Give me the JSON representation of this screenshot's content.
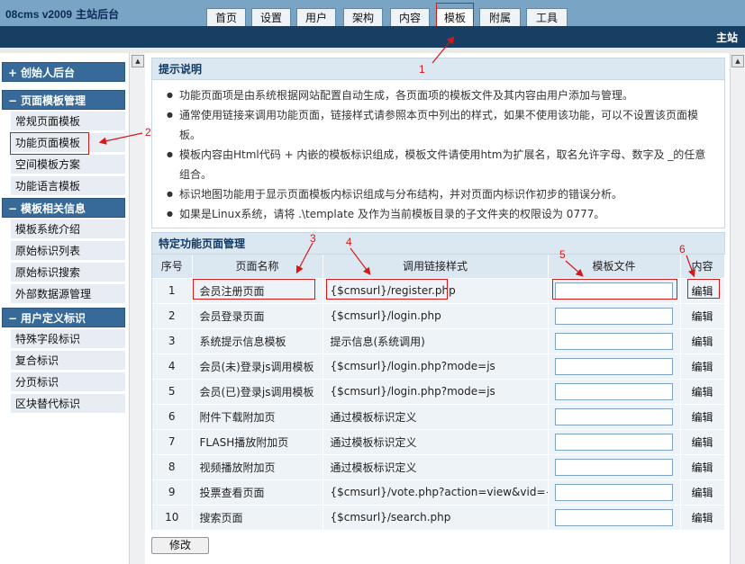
{
  "header": {
    "brand": "08cms v2009",
    "site": "主站后台",
    "nav": [
      "首页",
      "设置",
      "用户",
      "架构",
      "内容",
      "模板",
      "附属",
      "工具"
    ],
    "active_nav": "模板",
    "section_title": "主站"
  },
  "sidebar": {
    "groups": [
      {
        "symbol": "+",
        "title": "创始人后台",
        "items": []
      },
      {
        "symbol": "−",
        "title": "页面模板管理",
        "items": [
          "常规页面模板",
          "功能页面模板",
          "空间模板方案",
          "功能语言模板"
        ]
      },
      {
        "symbol": "−",
        "title": "模板相关信息",
        "items": [
          "模板系统介绍",
          "原始标识列表",
          "原始标识搜索",
          "外部数据源管理"
        ]
      },
      {
        "symbol": "−",
        "title": "用户定义标识",
        "items": [
          "特殊字段标识",
          "复合标识",
          "分页标识",
          "区块替代标识"
        ]
      }
    ]
  },
  "tips": {
    "title": "提示说明",
    "lines": [
      "功能页面项是由系统根据网站配置自动生成，各页面项的模板文件及其内容由用户添加与管理。",
      "通常使用链接来调用功能页面，链接样式请参照本页中列出的样式，如果不使用该功能，可以不设置该页面模",
      "板。",
      "模板内容由Html代码 + 内嵌的模板标识组成，模板文件请使用htm为扩展名，取名允许字母、数字及 _的任意",
      "组合。",
      "标识地图功能用于显示页面模板内标识组成与分布结构，并对页面内标识作初步的错误分析。",
      "如果是Linux系统，请将 .\\template 及作为当前模板目录的子文件夹的权限设为 0777。"
    ]
  },
  "panel": {
    "title": "特定功能页面管理",
    "columns": [
      "序号",
      "页面名称",
      "调用链接样式",
      "模板文件",
      "内容"
    ],
    "edit_label": "编辑",
    "rows": [
      {
        "no": "1",
        "name": "会员注册页面",
        "link": "{$cmsurl}/register.php",
        "file": ""
      },
      {
        "no": "2",
        "name": "会员登录页面",
        "link": "{$cmsurl}/login.php",
        "file": ""
      },
      {
        "no": "3",
        "name": "系统提示信息模板",
        "link": "提示信息(系统调用)",
        "file": ""
      },
      {
        "no": "4",
        "name": "会员(未)登录js调用模板",
        "link": "{$cmsurl}/login.php?mode=js",
        "file": ""
      },
      {
        "no": "5",
        "name": "会员(已)登录js调用模板",
        "link": "{$cmsurl}/login.php?mode=js",
        "file": ""
      },
      {
        "no": "6",
        "name": "附件下载附加页",
        "link": "通过模板标识定义",
        "file": ""
      },
      {
        "no": "7",
        "name": "FLASH播放附加页",
        "link": "通过模板标识定义",
        "file": ""
      },
      {
        "no": "8",
        "name": "视频播放附加页",
        "link": "通过模板标识定义",
        "file": ""
      },
      {
        "no": "9",
        "name": "投票查看页面",
        "link": "{$cmsurl}/vote.php?action=view&vid={$vid}",
        "file": ""
      },
      {
        "no": "10",
        "name": "搜索页面",
        "link": "{$cmsurl}/search.php",
        "file": ""
      }
    ],
    "submit_label": "修改"
  },
  "annotations": [
    "1",
    "2",
    "3",
    "4",
    "5",
    "6"
  ],
  "colors": {
    "top": "#7aa4c4",
    "section_bar": "#163f63",
    "group_header": "#386a99",
    "highlight": "#d41818"
  }
}
